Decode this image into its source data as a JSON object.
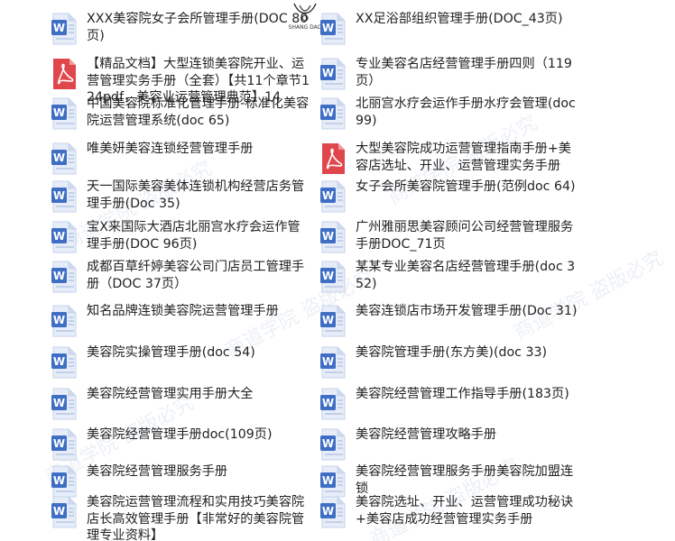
{
  "brand": {
    "logo_text": "SHANG DAO"
  },
  "watermarks": [
    "商道学院  盗版必究",
    "商道学院  盗版必究",
    "商道学院  盗版必究",
    "商道学院  盗版必究",
    "商道学院  盗版必究",
    "商道学院  盗版必究"
  ],
  "left_items": [
    {
      "icon": "word-doc-icon",
      "title": "XXX美容院女子会所管理手册(DOC 80页)"
    },
    {
      "icon": "pdf-icon",
      "title": "【精品文档】大型连锁美容院开业、运营管理实务手册（全套）【共11个章节124pdf，美容业运营管理典范】14"
    },
    {
      "icon": "word-doc-icon",
      "title": "中国美容院标准化管理手册-标准化美容院运营管理系统(doc 65)"
    },
    {
      "icon": "word-doc-icon",
      "title": "唯美妍美容连锁经营管理手册"
    },
    {
      "icon": "word-doc-icon",
      "title": "天一国际美容美体连锁机构经营店务管理手册(Doc 35)"
    },
    {
      "icon": "word-doc-icon",
      "title": "宝X来国际大酒店北丽宫水疗会运作管理手册(DOC 96页)"
    },
    {
      "icon": "word-doc-icon",
      "title": "成都百草纤婷美容公司门店员工管理手册（DOC 37页）"
    },
    {
      "icon": "word-doc-icon",
      "title": "知名品牌连锁美容院运营管理手册"
    },
    {
      "icon": "word-doc-icon",
      "title": "美容院实操管理手册(doc 54)"
    },
    {
      "icon": "word-doc-icon",
      "title": "美容院经营管理实用手册大全"
    },
    {
      "icon": "word-doc-icon",
      "title": "美容院经营管理手册doc(109页)"
    },
    {
      "icon": "word-doc-icon",
      "title": "美容院经营管理服务手册"
    },
    {
      "icon": "word-doc-icon",
      "title": "美容院运营管理流程和实用技巧美容院店长高效管理手册【非常好的美容院管理专业资料】"
    }
  ],
  "right_items": [
    {
      "icon": "word-doc-icon",
      "title": "XX足浴部组织管理手册(DOC_43页)"
    },
    {
      "icon": "word-doc-icon",
      "title": "专业美容名店经营管理手册四则（119页）"
    },
    {
      "icon": "word-doc-icon",
      "title": "北丽宫水疗会运作手册水疗会管理(doc 99)"
    },
    {
      "icon": "pdf-icon",
      "title": "大型美容院成功运营管理指南手册+美容店选址、开业、运营管理实务手册"
    },
    {
      "icon": "word-doc-icon",
      "title": "女子会所美容院管理手册(范例doc 64)"
    },
    {
      "icon": "word-doc-icon",
      "title": "广州雅丽思美容顾问公司经营管理服务手册DOC_71页"
    },
    {
      "icon": "word-doc-icon",
      "title": "某某专业美容名店经营管理手册(doc 352)"
    },
    {
      "icon": "word-doc-icon",
      "title": "美容连锁店市场开发管理手册(Doc 31)"
    },
    {
      "icon": "word-doc-icon",
      "title": "美容院管理手册(东方美)(doc 33)"
    },
    {
      "icon": "word-doc-icon",
      "title": "美容院经营管理工作指导手册(183页)"
    },
    {
      "icon": "word-doc-icon",
      "title": "美容院经营管理攻略手册"
    },
    {
      "icon": "word-doc-icon",
      "title": "美容院经营管理服务手册美容院加盟连锁"
    },
    {
      "icon": "word-doc-icon",
      "title": "美容院选址、开业、运营管理成功秘诀+美容店成功经营管理实务手册"
    }
  ],
  "colors": {
    "word_blue": "#3f6fc4",
    "word_light": "#e6edf8",
    "pdf_red": "#e0474c",
    "text": "#222222"
  }
}
